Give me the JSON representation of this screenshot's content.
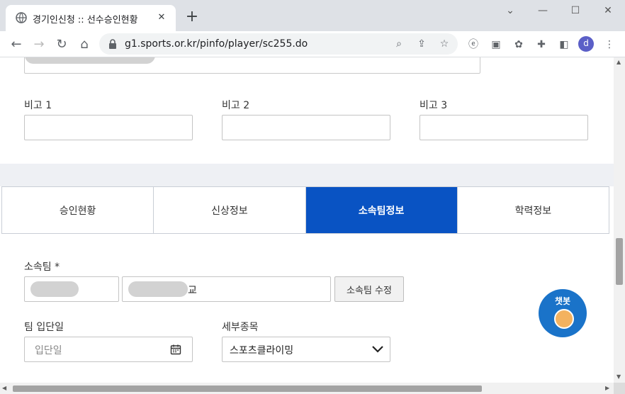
{
  "browser": {
    "tab_title": "경기인신청 :: 선수승인현황",
    "url": "g1.sports.or.kr/pinfo/player/sc255.do",
    "profile_initial": "d"
  },
  "form_top": {
    "remark1_label": "비고 1",
    "remark2_label": "비고 2",
    "remark3_label": "비고 3"
  },
  "tabs": [
    {
      "label": "승인현황"
    },
    {
      "label": "신상정보"
    },
    {
      "label": "소속팀정보"
    },
    {
      "label": "학력정보"
    }
  ],
  "active_tab": "소속팀정보",
  "team": {
    "label": "소속팀 *",
    "name_suffix": "교",
    "edit_button": "소속팀 수정",
    "join_date_label": "팀 입단일",
    "join_date_placeholder": "입단일",
    "sub_event_label": "세부종목",
    "sub_event_value": "스포츠클라이밍"
  },
  "chatbot": {
    "label": "챗봇"
  },
  "colors": {
    "active_tab": "#0953c3",
    "chatbot": "#1a73c9"
  }
}
